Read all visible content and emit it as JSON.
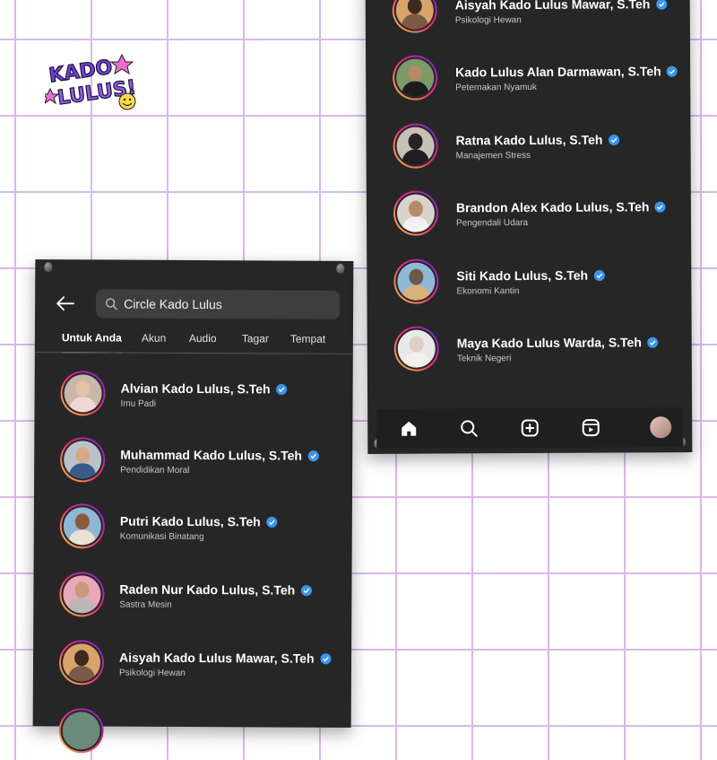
{
  "logo": {
    "line1": "KADO",
    "line2": "LULUS!",
    "icon": "smiley-icon"
  },
  "search": {
    "query": "Circle Kado Lulus",
    "back_icon": "back-arrow-icon",
    "search_icon": "search-icon"
  },
  "tabs": [
    {
      "label": "Untuk Anda",
      "active": true
    },
    {
      "label": "Akun",
      "active": false
    },
    {
      "label": "Audio",
      "active": false
    },
    {
      "label": "Tagar",
      "active": false
    },
    {
      "label": "Tempat",
      "active": false
    }
  ],
  "left_list": [
    {
      "name": "Alvian Kado Lulus, S.Teh",
      "subtitle": "Imu Padi",
      "verified": true
    },
    {
      "name": "Muhammad Kado Lulus, S.Teh",
      "subtitle": "Pendidikan Moral",
      "verified": true
    },
    {
      "name": "Putri Kado Lulus, S.Teh",
      "subtitle": "Komunikasi Binatang",
      "verified": true
    },
    {
      "name": "Raden Nur Kado Lulus, S.Teh",
      "subtitle": "Sastra Mesin",
      "verified": true
    },
    {
      "name": "Aisyah Kado Lulus Mawar, S.Teh",
      "subtitle": "Psikologi Hewan",
      "verified": true
    }
  ],
  "right_list": [
    {
      "name": "Aisyah Kado Lulus Mawar, S.Teh",
      "subtitle": "Psikologi Hewan",
      "verified": true
    },
    {
      "name": "Kado Lulus Alan Darmawan, S.Teh",
      "subtitle": "Peternakan Nyamuk",
      "verified": true
    },
    {
      "name": "Ratna Kado Lulus, S.Teh",
      "subtitle": "Manajemen Stress",
      "verified": true
    },
    {
      "name": "Brandon Alex Kado Lulus, S.Teh",
      "subtitle": "Pengendali Udara",
      "verified": true
    },
    {
      "name": "Siti Kado Lulus, S.Teh",
      "subtitle": "Ekonomi Kantin",
      "verified": true
    },
    {
      "name": "Maya Kado Lulus Warda, S.Teh",
      "subtitle": "Teknik Negeri",
      "verified": true
    }
  ],
  "navbar": [
    "home-icon",
    "search-icon",
    "add-post-icon",
    "reels-icon",
    "profile-avatar"
  ],
  "colors": {
    "background": "#ffffff",
    "grid": "#d8b8ee",
    "panel": "#262626",
    "verified": "#3897f0",
    "logo_purple": "#7b3fe4",
    "logo_pink": "#f06ecb"
  }
}
